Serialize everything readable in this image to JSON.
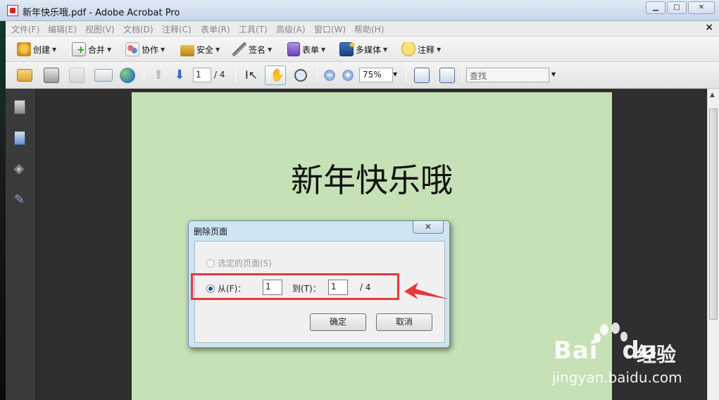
{
  "window": {
    "title": "新年快乐哦.pdf - Adobe Acrobat Pro",
    "controls": {
      "minimize": "▭",
      "maximize": "□",
      "close": "✕"
    }
  },
  "menubar": {
    "items": [
      "文件(F)",
      "编辑(E)",
      "视图(V)",
      "文档(D)",
      "注释(C)",
      "表单(R)",
      "工具(T)",
      "高级(A)",
      "窗口(W)",
      "帮助(H)"
    ],
    "doc_close": "×"
  },
  "toolbar": {
    "buttons": [
      {
        "label": "创建",
        "icon": "create-icon"
      },
      {
        "label": "合并",
        "icon": "combine-icon"
      },
      {
        "label": "协作",
        "icon": "collaborate-icon"
      },
      {
        "label": "安全",
        "icon": "lock-icon"
      },
      {
        "label": "签名",
        "icon": "pen-icon"
      },
      {
        "label": "表单",
        "icon": "form-icon"
      },
      {
        "label": "多媒体",
        "icon": "multimedia-icon"
      },
      {
        "label": "注释",
        "icon": "comment-icon"
      }
    ]
  },
  "nav": {
    "page_current": "1",
    "page_total": "/ 4",
    "zoom": "75%",
    "search_placeholder": "查找"
  },
  "document": {
    "heading": "新年快乐哦"
  },
  "dialog": {
    "title": "删除页面",
    "close": "✕",
    "option_selected_pages": "选定的页面(S)",
    "option_from": "从(F)：",
    "from_value": "1",
    "to_label": "到(T)：",
    "to_value": "1",
    "total": "/ 4",
    "ok": "确定",
    "cancel": "取消"
  },
  "watermark": {
    "logo": "Bai",
    "logo_end": "du",
    "brand": "经验",
    "url": "jingyan.baidu.com"
  },
  "colors": {
    "page_background": "#c5e1b5",
    "annotation_red": "#e53838",
    "dialog_frame": "#cfe4f3"
  }
}
